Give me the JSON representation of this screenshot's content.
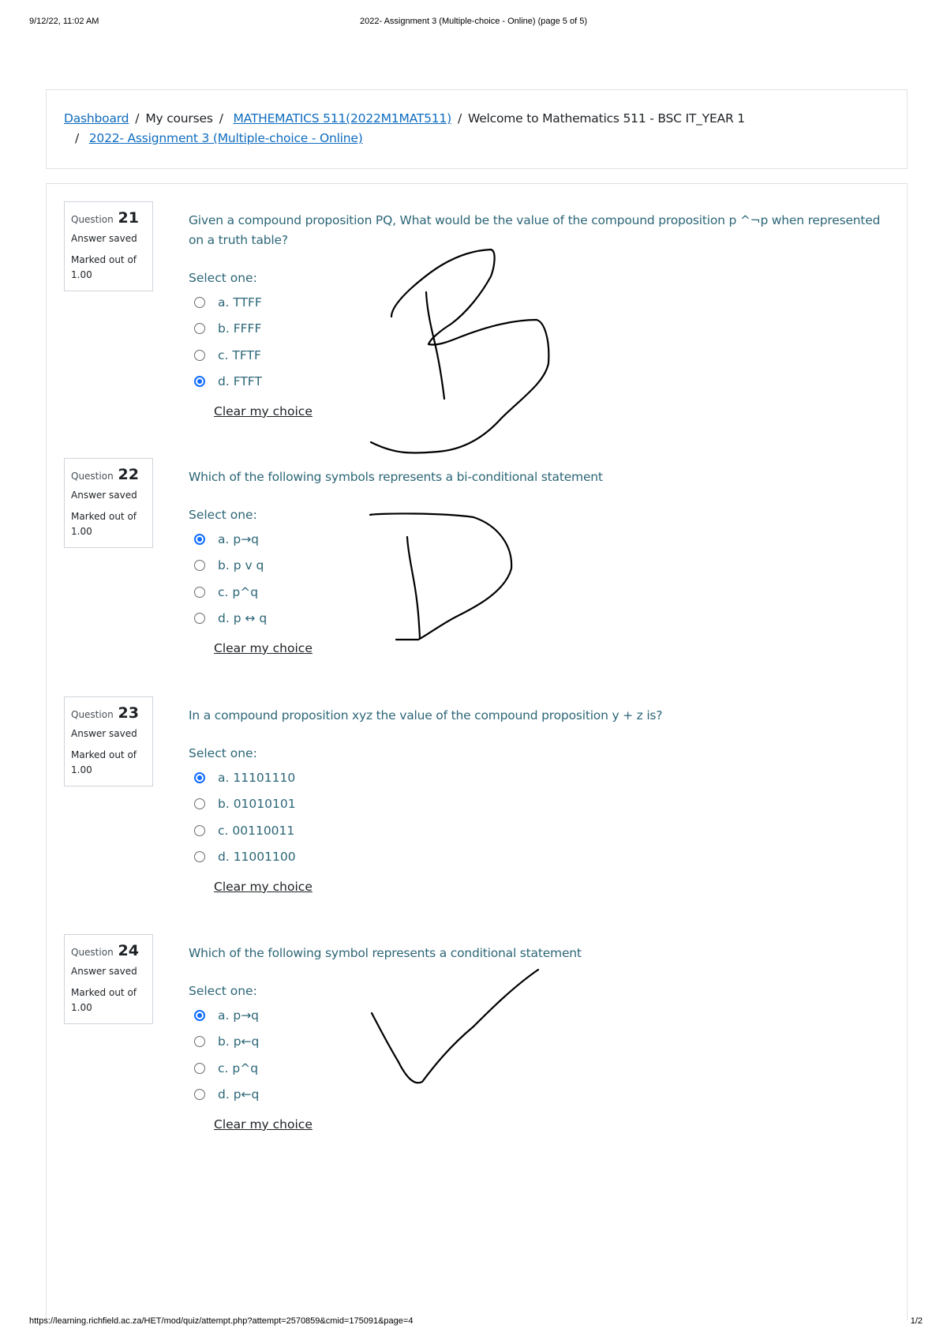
{
  "print_header": {
    "datetime": "9/12/22, 11:02 AM",
    "title": "2022- Assignment 3 (Multiple-choice - Online) (page 5 of 5)"
  },
  "print_footer": {
    "url": "https://learning.richfield.ac.za/HET/mod/quiz/attempt.php?attempt=2570859&cmid=175091&page=4",
    "page": "1/2"
  },
  "breadcrumb": {
    "items": [
      {
        "label": "Dashboard",
        "link": true
      },
      {
        "label": "My courses",
        "link": false
      },
      {
        "label": "MATHEMATICS 511(2022M1MAT511)",
        "link": true
      },
      {
        "label": "Welcome to Mathematics 511 - BSC IT_YEAR 1",
        "link": false
      },
      {
        "label": "2022- Assignment 3 (Multiple-choice - Online)",
        "link": true
      }
    ],
    "separator": "/"
  },
  "common": {
    "question_prefix": "Question",
    "select_one": "Select one:",
    "clear_choice": "Clear my choice"
  },
  "questions": [
    {
      "number": "21",
      "state": "Answer saved",
      "grade": "Marked out of 1.00",
      "text": "Given a compound proposition PQ, What would be the value of the compound proposition p ^¬p when represented on a truth table?",
      "answers": [
        {
          "label": "a. TTFF",
          "checked": false
        },
        {
          "label": "b. FFFF",
          "checked": false
        },
        {
          "label": "c. TFTF",
          "checked": false
        },
        {
          "label": "d. FTFT",
          "checked": true
        }
      ],
      "annotation": "B"
    },
    {
      "number": "22",
      "state": "Answer saved",
      "grade": "Marked out of 1.00",
      "text": "Which of the following symbols represents a bi-conditional statement",
      "answers": [
        {
          "label": "a. p→q",
          "checked": true
        },
        {
          "label": "b. p v q",
          "checked": false
        },
        {
          "label": "c. p^q",
          "checked": false
        },
        {
          "label": "d. p ↔ q",
          "checked": false
        }
      ],
      "annotation": "D"
    },
    {
      "number": "23",
      "state": "Answer saved",
      "grade": "Marked out of 1.00",
      "text": "In a compound proposition xyz the value of the compound proposition y + z is?",
      "answers": [
        {
          "label": "a. 11101110",
          "checked": true
        },
        {
          "label": "b. 01010101",
          "checked": false
        },
        {
          "label": "c. 00110011",
          "checked": false
        },
        {
          "label": "d. 11001100",
          "checked": false
        }
      ],
      "annotation": ""
    },
    {
      "number": "24",
      "state": "Answer saved",
      "grade": "Marked out of 1.00",
      "text": "Which of the following symbol represents a conditional statement",
      "answers": [
        {
          "label": "a. p→q",
          "checked": true
        },
        {
          "label": "b. p←q",
          "checked": false
        },
        {
          "label": "c. p^q",
          "checked": false
        },
        {
          "label": "d. p←q",
          "checked": false
        }
      ],
      "annotation": "checkmark"
    }
  ],
  "colors": {
    "link": "#0f6cbf",
    "question_text": "#2c6677",
    "radio_checked": "#0f6cff",
    "border": "#dee2e6"
  }
}
